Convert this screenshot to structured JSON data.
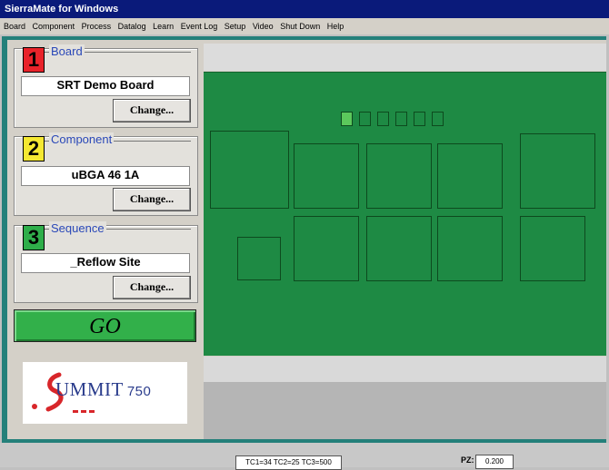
{
  "app": {
    "title": "SierraMate for Windows"
  },
  "menu": [
    "Board",
    "Component",
    "Process",
    "Datalog",
    "Learn",
    "Event Log",
    "Setup",
    "Video",
    "Shut Down",
    "Help"
  ],
  "left": {
    "groups": [
      {
        "number": "1",
        "number_color": "#e8232a",
        "title": "Board",
        "value": "SRT Demo Board",
        "button": "Change..."
      },
      {
        "number": "2",
        "number_color": "#f5e832",
        "title": "Component",
        "value": "uBGA 46 1A",
        "button": "Change..."
      },
      {
        "number": "3",
        "number_color": "#2fae4a",
        "title": "Sequence",
        "value": "_Reflow Site",
        "button": "Change..."
      }
    ],
    "go_label": "GO",
    "logo": {
      "text": "UMMIT",
      "number": "750"
    }
  },
  "board": {
    "color": "#1e8a44",
    "leds": 6,
    "active_led": 0
  },
  "status": {
    "tc": "TC1=34 TC2=25 TC3=500",
    "pz_label": "PZ:",
    "pz_value": "0.200"
  }
}
